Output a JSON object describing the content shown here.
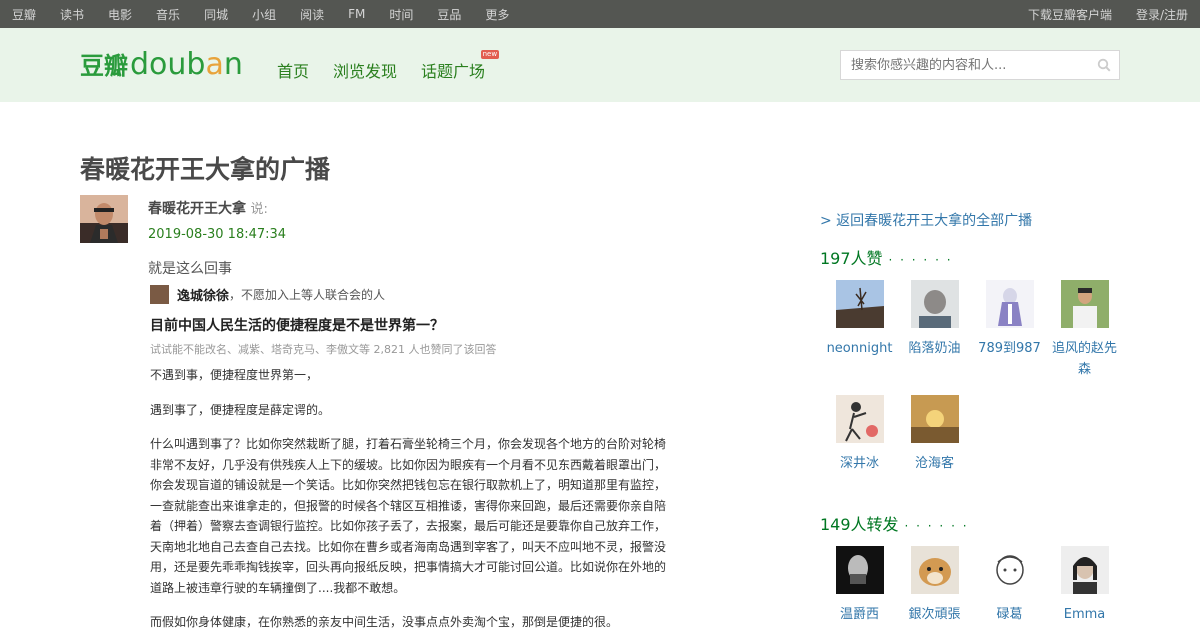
{
  "topnav": {
    "links": [
      "豆瓣",
      "读书",
      "电影",
      "音乐",
      "同城",
      "小组",
      "阅读",
      "FM",
      "时间",
      "豆品",
      "更多"
    ],
    "download": "下载豆瓣客户端",
    "login": "登录/注册"
  },
  "header": {
    "logo_cn": "豆瓣",
    "logo_en": "douban",
    "nav": [
      "首页",
      "浏览发现",
      "话题广场"
    ],
    "new_badge": "new",
    "search_placeholder": "搜索你感兴趣的内容和人..."
  },
  "status": {
    "title": "春暖花开王大拿的广播",
    "author": "春暖花开王大拿",
    "said": "说:",
    "datetime": "2019-08-30 18:47:34",
    "text": "就是这么回事"
  },
  "quote": {
    "user_name": "逸城徐徐",
    "user_bio": "，不愿加入上等人联合会的人",
    "question": "目前中国人民生活的便捷程度是不是世界第一？",
    "stats": "试试能不能改名、减紫、塔奇克马、李傲文等 2,821 人也赞同了该回答",
    "paragraphs": [
      "不遇到事，便捷程度世界第一，",
      "遇到事了，便捷程度是薛定谔的。",
      "什么叫遇到事了？比如你突然栽断了腿，打着石膏坐轮椅三个月，你会发现各个地方的台阶对轮椅非常不友好，几乎没有供残疾人上下的缓坡。比如你因为眼疾有一个月看不见东西戴着眼罩出门，你会发现盲道的铺设就是一个笑话。比如你突然把钱包忘在银行取款机上了，明知道那里有监控，一查就能查出来谁拿走的，但报警的时候各个辖区互相推诿，害得你来回跑，最后还需要你亲自陪着（押着）警察去查调银行监控。比如你孩子丢了，去报案，最后可能还是要靠你自己放弃工作，天南地北地自己去查自己去找。比如你在曹乡或者海南岛遇到宰客了，叫天不应叫地不灵，报警没用，还是要先乖乖掏钱挨宰，回头再向报纸反映，把事情搞大才可能讨回公道。比如说你在外地的道路上被违章行驶的车辆撞倒了....我都不敢想。",
      "而假如你身体健康，在你熟悉的亲友中间生活，没事点点外卖淘个宝，那倒是便捷的很。"
    ]
  },
  "sidebar": {
    "back_link": "> 返回春暖花开王大拿的全部广播",
    "likes_title": "197人赞",
    "dots": "· · · · · ·",
    "likes": [
      "neonnight",
      "陷落奶油",
      "789到987",
      "追风的赵先森",
      "深井冰",
      "沧海客"
    ],
    "reshares_title": "149人转发",
    "reshares": [
      "温爵西",
      "銀次頑張",
      "碌葛",
      "Emma"
    ]
  },
  "colors": {
    "topnav_bg": "#545652",
    "header_bg": "#e9f4e9",
    "link": "#3377aa",
    "green": "#007722"
  }
}
